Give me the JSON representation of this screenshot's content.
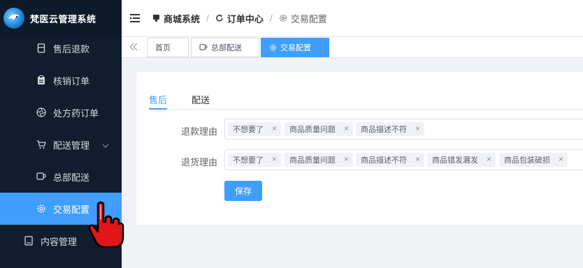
{
  "app": {
    "title": "梵医云管理系统"
  },
  "sidebar": {
    "items": [
      {
        "label": "售后退款",
        "icon": "receipt-icon"
      },
      {
        "label": "核销订单",
        "icon": "clipboard-icon"
      },
      {
        "label": "处方药订单",
        "icon": "aperture-icon"
      },
      {
        "label": "配送管理",
        "icon": "cart-icon"
      },
      {
        "label": "总部配送",
        "icon": "cup-icon"
      },
      {
        "label": "交易配置",
        "icon": "gear-icon"
      },
      {
        "label": "内容管理",
        "icon": "book-icon"
      }
    ],
    "active_index": 5
  },
  "breadcrumb": {
    "items": [
      {
        "label": "商城系统",
        "icon": "shop-icon"
      },
      {
        "label": "订单中心",
        "icon": "refresh-icon"
      },
      {
        "label": "交易配置",
        "icon": "gear-icon"
      }
    ],
    "separator": "/"
  },
  "tags_view": {
    "tags": [
      {
        "label": "首页"
      },
      {
        "label": "总部配送",
        "icon": "cup-icon"
      },
      {
        "label": "交易配置",
        "icon": "gear-icon"
      }
    ],
    "active_index": 2
  },
  "content": {
    "tabs": [
      {
        "label": "售后"
      },
      {
        "label": "配送"
      }
    ],
    "active_tab": 0,
    "refund_reasons": {
      "label": "退款理由",
      "values": [
        "不想要了",
        "商品质量问题",
        "商品描述不符"
      ]
    },
    "return_reasons": {
      "label": "退货理由",
      "values": [
        "不想要了",
        "商品质量问题",
        "商品描述不符",
        "商品错发漏发",
        "商品包装破损"
      ]
    },
    "save_label": "保存"
  },
  "colors": {
    "sidebar_bg": "#0f1d2e",
    "accent": "#409eff",
    "page_bg": "#f0f2f5"
  }
}
